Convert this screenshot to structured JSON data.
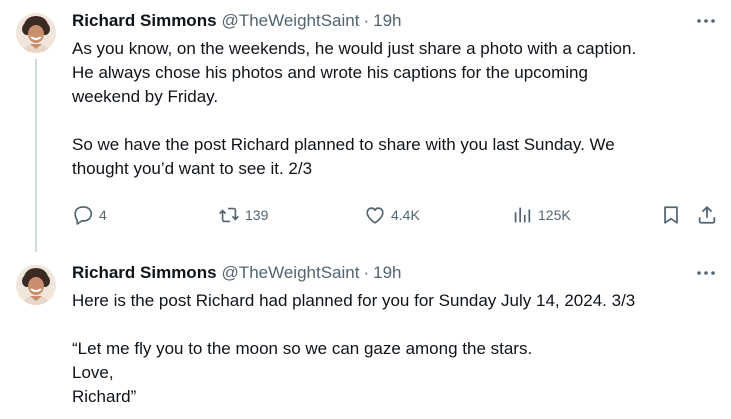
{
  "tweets": [
    {
      "author": {
        "name": "Richard Simmons",
        "handle": "@TheWeightSaint",
        "time": "19h",
        "separator": "·"
      },
      "lines": [
        "As you know, on the weekends, he would just share a photo with a caption.",
        "He always chose his photos and wrote his captions for the upcoming",
        "weekend by Friday.",
        "",
        "So we have the post Richard planned to share with you last Sunday.  We",
        "thought you’d want to see it.   2/3"
      ],
      "stats": {
        "replies": "4",
        "reposts": "139",
        "likes": "4.4K",
        "views": "125K"
      }
    },
    {
      "author": {
        "name": "Richard Simmons",
        "handle": "@TheWeightSaint",
        "time": "19h",
        "separator": "·"
      },
      "lines": [
        "Here is the post Richard had planned for you for Sunday July 14, 2024.   3/3",
        "",
        "“Let me fly you to the moon so we can gaze among the stars.",
        "Love,",
        "Richard”"
      ]
    }
  ],
  "icons": {
    "reply": "reply-icon",
    "repost": "repost-icon",
    "like": "heart-icon",
    "views": "views-icon",
    "bookmark": "bookmark-icon",
    "share": "share-icon",
    "more": "more-icon"
  },
  "colors": {
    "text": "#0f1419",
    "muted": "#536471",
    "thread_line": "#cfd9de"
  }
}
